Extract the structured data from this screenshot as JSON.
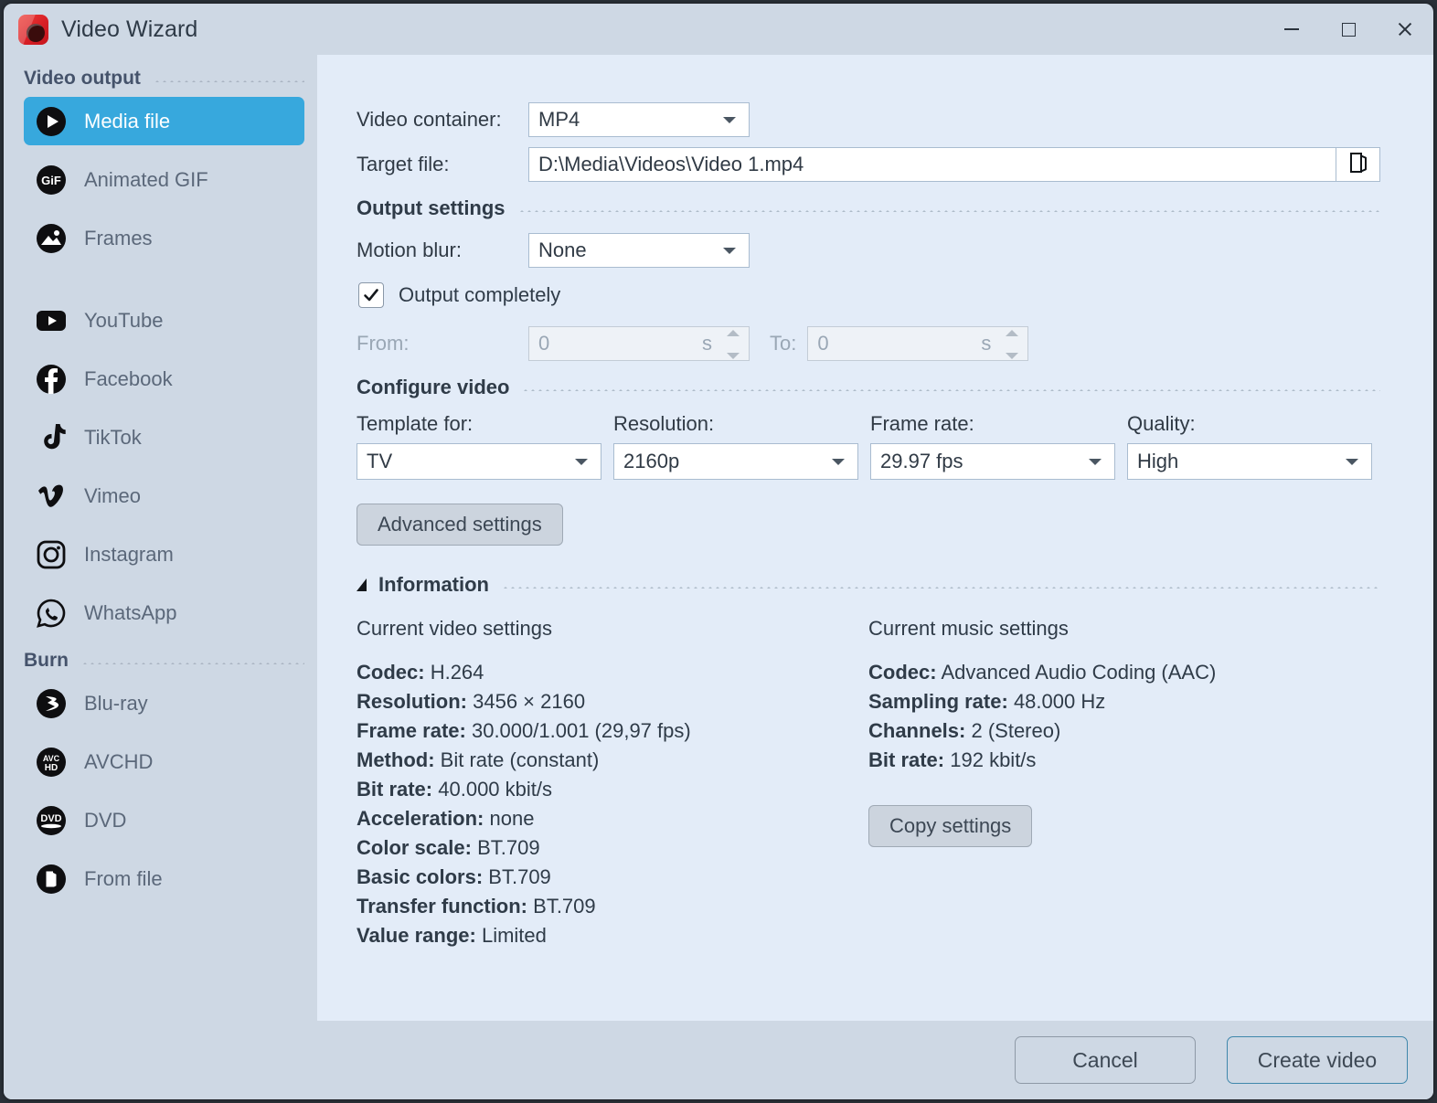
{
  "window": {
    "title": "Video Wizard",
    "app_icon": "video-wizard-logo",
    "minimize": "minimize-icon",
    "maximize": "maximize-icon",
    "close": "close-icon"
  },
  "sidebar": {
    "sections": [
      {
        "title": "Video output",
        "items": [
          {
            "label": "Media file",
            "icon": "play-circle-icon",
            "active": true
          },
          {
            "label": "Animated GIF",
            "icon": "gif-circle-icon",
            "active": false
          },
          {
            "label": "Frames",
            "icon": "image-circle-icon",
            "active": false
          },
          {
            "label": "YouTube",
            "icon": "youtube-icon",
            "active": false
          },
          {
            "label": "Facebook",
            "icon": "facebook-icon",
            "active": false
          },
          {
            "label": "TikTok",
            "icon": "tiktok-icon",
            "active": false
          },
          {
            "label": "Vimeo",
            "icon": "vimeo-icon",
            "active": false
          },
          {
            "label": "Instagram",
            "icon": "instagram-icon",
            "active": false
          },
          {
            "label": "WhatsApp",
            "icon": "whatsapp-icon",
            "active": false
          }
        ]
      },
      {
        "title": "Burn",
        "items": [
          {
            "label": "Blu-ray",
            "icon": "bluray-icon",
            "active": false
          },
          {
            "label": "AVCHD",
            "icon": "avchd-icon",
            "active": false
          },
          {
            "label": "DVD",
            "icon": "dvd-icon",
            "active": false
          },
          {
            "label": "From file",
            "icon": "from-file-icon",
            "active": false
          }
        ]
      }
    ]
  },
  "main": {
    "video_container": {
      "label": "Video container:",
      "value": "MP4"
    },
    "target_file": {
      "label": "Target file:",
      "value": "D:\\Media\\Videos\\Video 1.mp4",
      "browse_icon": "open-folder-icon"
    },
    "output_settings": {
      "title": "Output settings"
    },
    "motion_blur": {
      "label": "Motion blur:",
      "value": "None"
    },
    "output_completely": {
      "label": "Output completely",
      "checked": true
    },
    "range": {
      "from_label": "From:",
      "from_value": "0",
      "from_unit": "s",
      "to_label": "To:",
      "to_value": "0",
      "to_unit": "s"
    },
    "configure_video": {
      "title": "Configure video"
    },
    "config": [
      {
        "caption": "Template for:",
        "value": "TV"
      },
      {
        "caption": "Resolution:",
        "value": "2160p"
      },
      {
        "caption": "Frame rate:",
        "value": "29.97 fps"
      },
      {
        "caption": "Quality:",
        "value": "High"
      }
    ],
    "advanced_settings_label": "Advanced settings",
    "information": {
      "title": "Information",
      "collapse_icon": "triangle-collapse-icon"
    },
    "video_settings": {
      "heading": "Current video settings",
      "rows": [
        {
          "key": "Codec:",
          "value": "H.264"
        },
        {
          "key": "Resolution:",
          "value": "3456 × 2160"
        },
        {
          "key": "Frame rate:",
          "value": "30.000/1.001 (29,97 fps)"
        },
        {
          "key": "Method:",
          "value": "Bit rate (constant)"
        },
        {
          "key": "Bit rate:",
          "value": "40.000 kbit/s"
        },
        {
          "key": "Acceleration:",
          "value": "none"
        },
        {
          "key": "Color scale:",
          "value": "BT.709"
        },
        {
          "key": "Basic colors:",
          "value": "BT.709"
        },
        {
          "key": "Transfer function:",
          "value": "BT.709"
        },
        {
          "key": "Value range:",
          "value": "Limited"
        }
      ]
    },
    "music_settings": {
      "heading": "Current music settings",
      "rows": [
        {
          "key": "Codec:",
          "value": "Advanced Audio Coding (AAC)"
        },
        {
          "key": "Sampling rate:",
          "value": "48.000 Hz"
        },
        {
          "key": "Channels:",
          "value": "2 (Stereo)"
        },
        {
          "key": "Bit rate:",
          "value": "192 kbit/s"
        }
      ],
      "copy_settings_label": "Copy settings"
    }
  },
  "footer": {
    "cancel_label": "Cancel",
    "create_label": "Create video"
  },
  "colors": {
    "accent": "#37a8dd",
    "sidebar_bg": "#ced8e4",
    "panel_bg": "#e3ecf8",
    "primary_border": "#3f87ab",
    "logo_red": "#d81f26"
  }
}
